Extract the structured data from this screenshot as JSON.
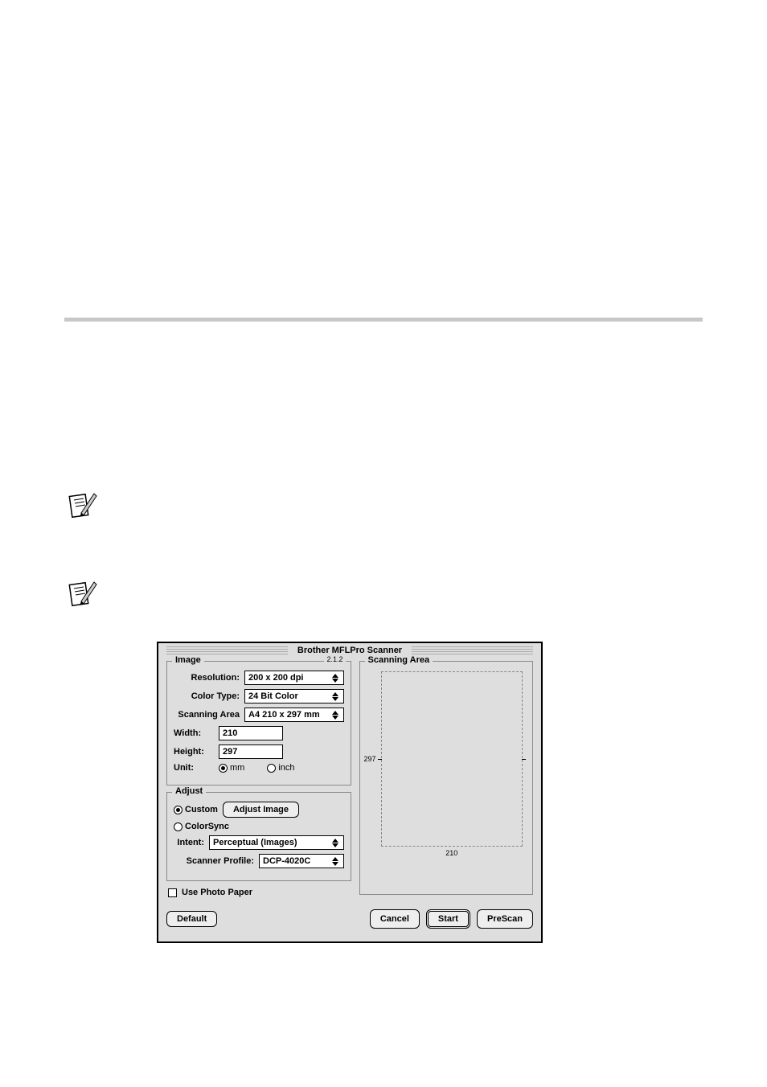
{
  "dialog": {
    "title": "Brother MFLPro Scanner",
    "version": "2.1.2",
    "image_group": {
      "label": "Image",
      "resolution_label": "Resolution:",
      "resolution": "200 x 200 dpi",
      "colortype_label": "Color Type:",
      "colortype": "24 Bit Color",
      "scanning_area_label": "Scanning Area",
      "scanning_area": "A4 210 x 297 mm",
      "width_label": "Width:",
      "width": "210",
      "height_label": "Height:",
      "height": "297",
      "unit_label": "Unit:",
      "unit_mm": "mm",
      "unit_inch": "inch",
      "unit_selected": "mm"
    },
    "adjust_group": {
      "label": "Adjust",
      "custom": "Custom",
      "adjust_image_btn": "Adjust Image",
      "colorsync": "ColorSync",
      "intent_label": "Intent:",
      "intent": "Perceptual (Images)",
      "scanner_profile_label": "Scanner Profile:",
      "scanner_profile": "DCP-4020C",
      "adjust_selected": "Custom"
    },
    "use_photo_paper": "Use Photo Paper",
    "scanning_area_panel": {
      "label": "Scanning Area",
      "ruler_h": "210",
      "ruler_v": "297"
    },
    "buttons": {
      "default": "Default",
      "cancel": "Cancel",
      "start": "Start",
      "prescan": "PreScan"
    }
  }
}
